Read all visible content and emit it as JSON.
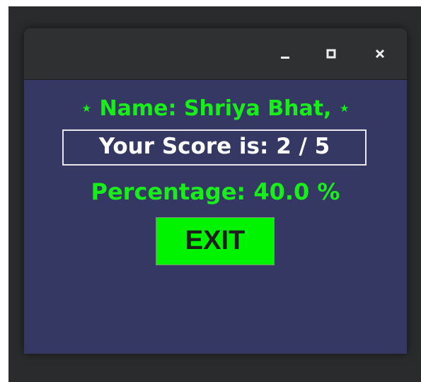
{
  "window": {
    "controls": {
      "minimize_icon": "minimize-icon",
      "maximize_icon": "maximize-icon",
      "close_icon": "close-icon"
    }
  },
  "result": {
    "star_glyph": "⋆",
    "name_text": "Name: Shriya Bhat,",
    "score_text": "Your Score is: 2 / 5",
    "percentage_text": "Percentage: 40.0 %",
    "exit_label": "EXIT"
  },
  "colors": {
    "background": "#353863",
    "accent_green": "#18ee1a",
    "button_green": "#00f400",
    "score_text": "#ffffff"
  }
}
